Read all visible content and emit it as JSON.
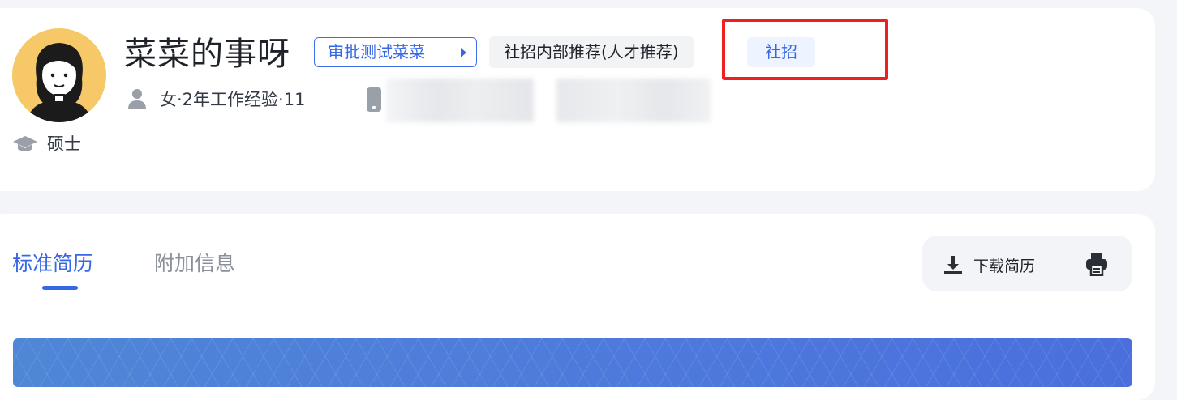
{
  "profile": {
    "name": "菜菜的事呀",
    "approval_tag": "审批测试菜菜",
    "channel_tag": "社招内部推荐(人才推荐)",
    "type_tag": "社招",
    "meta": "女·2年工作经验·11",
    "education": "硕士"
  },
  "tabs": [
    {
      "label": "标准简历",
      "active": true
    },
    {
      "label": "附加信息",
      "active": false
    }
  ],
  "toolbar": {
    "download_label": "下载简历"
  },
  "colors": {
    "accent": "#3568e6",
    "highlight_box": "#ee1f1f",
    "avatar_bg": "#f6c867"
  },
  "icons": [
    "person-icon",
    "phone-icon",
    "graduation-cap-icon",
    "download-icon",
    "print-icon",
    "caret-right-icon"
  ]
}
